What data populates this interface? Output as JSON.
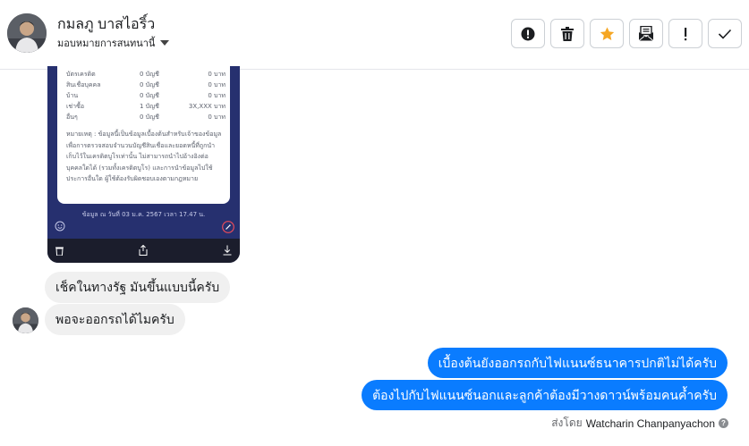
{
  "header": {
    "contact_name": "กมลภู บาสไอริ์ว",
    "assign_label": "มอบหมายการสนทนานี้",
    "actions": [
      {
        "name": "report-spam-button",
        "icon": "alert-circle-icon"
      },
      {
        "name": "delete-button",
        "icon": "trash-icon"
      },
      {
        "name": "star-button",
        "icon": "star-icon"
      },
      {
        "name": "mark-unread-button",
        "icon": "envelope-icon"
      },
      {
        "name": "follow-up-button",
        "icon": "exclamation-icon"
      },
      {
        "name": "mark-done-button",
        "icon": "check-icon"
      }
    ],
    "colors": {
      "star": "#f5a623",
      "icon": "#1c1e21"
    }
  },
  "attachment": {
    "rows": [
      {
        "label": "บัตรเครดิต",
        "count": "0 บัญชี",
        "amount": "0 บาท"
      },
      {
        "label": "สินเชื่อบุคคล",
        "count": "0 บัญชี",
        "amount": "0 บาท"
      },
      {
        "label": "บ้าน",
        "count": "0 บัญชี",
        "amount": "0 บาท"
      },
      {
        "label": "เช่าซื้อ",
        "count": "1 บัญชี",
        "amount": "3X,XXX บาท"
      },
      {
        "label": "อื่นๆ",
        "count": "0 บัญชี",
        "amount": "0 บาท"
      }
    ],
    "note": "หมายเหตุ : ข้อมูลนี้เป็นข้อมูลเบื้องต้นสำหรับเจ้าของข้อมูล เพื่อการตรวจสอบจำนวนบัญชีสินเชื่อและยอดหนี้ที่ถูกนำเก็บไว้ในเครดิตบูโรเท่านั้น ไม่สามารถนำไปอ้างอิงต่อบุคคลใดได้ (รวมทั้งเครดิตบูโร) และการนำข้อมูลไปใช้ประการอื่นใด ผู้ใช้ต้องรับผิดชอบเองตามกฎหมาย",
    "date_text": "ข้อมูล ณ วันที่ 03 ม.ค. 2567 เวลา 17.47 น."
  },
  "messages": {
    "incoming": [
      "เช็คในทางรัฐ มันขึ้นแบบนี้ครับ",
      "พอจะออกรถได้ไมครับ"
    ],
    "outgoing": [
      "เบื้องต้นยังออกรถกับไฟแนนซ์ธนาคารปกติไม่ได้ครับ",
      "ต้องไปกับไฟแนนซ์นอกและลูกค้าต้องมีวางดาวน์พร้อมคนค้ำครับ"
    ],
    "sent_by_prefix": "ส่งโดย",
    "sender_name": "Watcharin Chanpanyachon"
  },
  "colors": {
    "outgoing_bubble": "#0a7cff",
    "incoming_bubble": "#f0f0f0",
    "phone_bg": "#26306f"
  }
}
